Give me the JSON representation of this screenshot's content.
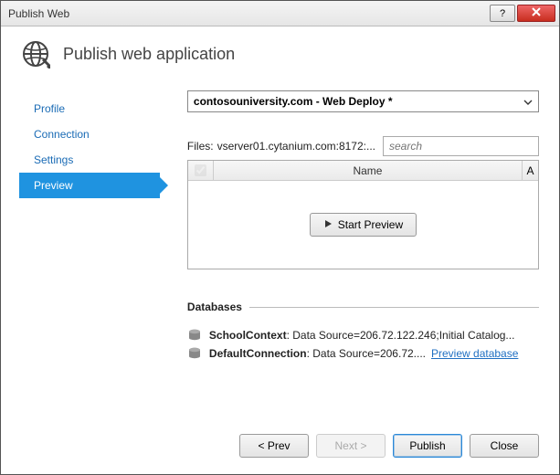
{
  "window": {
    "title": "Publish Web"
  },
  "header": {
    "title": "Publish web application"
  },
  "sidebar": {
    "items": [
      {
        "label": "Profile",
        "active": false
      },
      {
        "label": "Connection",
        "active": false
      },
      {
        "label": "Settings",
        "active": false
      },
      {
        "label": "Preview",
        "active": true
      }
    ]
  },
  "profile": {
    "selected": "contosouniversity.com - Web Deploy *"
  },
  "files": {
    "label": "Files:",
    "path": "vserver01.cytanium.com:8172:..."
  },
  "search": {
    "placeholder": "search"
  },
  "grid": {
    "columns": {
      "name": "Name",
      "extra": "A"
    },
    "preview_button": "Start Preview"
  },
  "databases": {
    "heading": "Databases",
    "rows": [
      {
        "name": "SchoolContext",
        "detail": ": Data Source=206.72.122.246;Initial Catalog..."
      },
      {
        "name": "DefaultConnection",
        "detail": ": Data Source=206.72....",
        "link": "Preview database"
      }
    ]
  },
  "footer": {
    "prev": "< Prev",
    "next": "Next >",
    "publish": "Publish",
    "close": "Close"
  }
}
